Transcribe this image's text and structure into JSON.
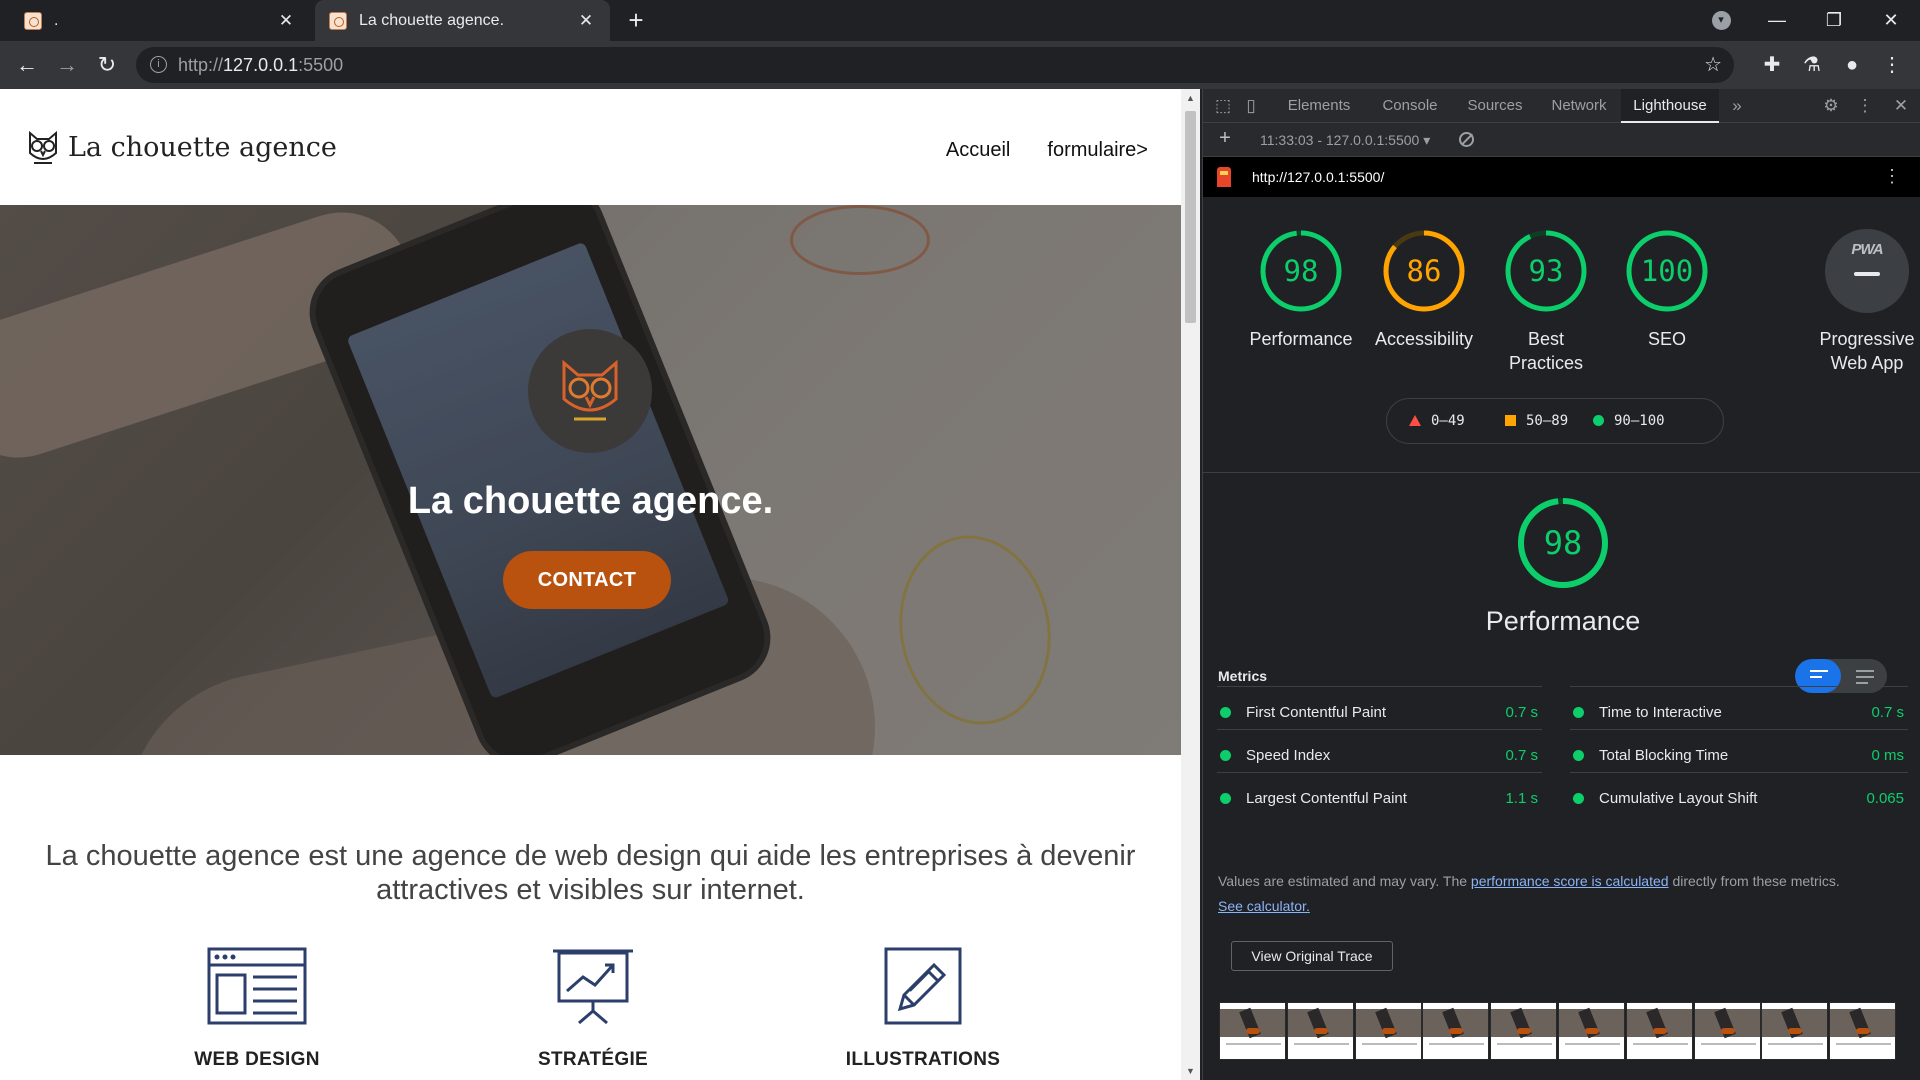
{
  "browser": {
    "tabs": [
      {
        "title": "."
      },
      {
        "title": "La chouette agence."
      }
    ],
    "address": {
      "scheme": "http://",
      "host": "127.0.0.1",
      "port": ":5500"
    },
    "icons": {
      "back": "arrow-left-icon",
      "forward": "arrow-right-icon",
      "reload": "reload-icon",
      "star": "bookmark-star-icon",
      "extensions": "puzzle-icon",
      "labs": "flask-icon",
      "profile": "person-icon",
      "menu": "kebab-menu-icon"
    }
  },
  "site": {
    "brand": "La chouette agence",
    "nav": [
      "Accueil",
      "formulaire>"
    ],
    "hero_title": "La chouette agence.",
    "cta": "CONTACT",
    "intro": "La chouette agence est une agence de web design qui aide les entreprises à devenir attractives et visibles sur internet.",
    "services": [
      {
        "label": "WEB DESIGN",
        "icon": "browser-window-icon"
      },
      {
        "label": "STRATÉGIE",
        "icon": "presentation-chart-icon"
      },
      {
        "label": "ILLUSTRATIONS",
        "icon": "pencil-icon"
      }
    ],
    "colors": {
      "accent": "#b9510f",
      "badge": "#3c3939"
    }
  },
  "devtools": {
    "tabs": [
      "Elements",
      "Console",
      "Sources",
      "Network",
      "Lighthouse"
    ],
    "active_tab": "Lighthouse",
    "overflow": "»",
    "run": "11:33:03 - 127.0.0.1:5500 ▾",
    "report_url": "http://127.0.0.1:5500/",
    "scores": [
      {
        "name": "Performance",
        "value": "98",
        "fraction": 0.98,
        "color": "#0cce6b"
      },
      {
        "name": "Accessibility",
        "value": "86",
        "fraction": 0.86,
        "color": "#ffa400"
      },
      {
        "name": "Best Practices",
        "value": "93",
        "fraction": 0.93,
        "color": "#0cce6b"
      },
      {
        "name": "SEO",
        "value": "100",
        "fraction": 1.0,
        "color": "#0cce6b"
      },
      {
        "name": "Progressive Web App",
        "badge": "PWA"
      }
    ],
    "legend": [
      "0–49",
      "50–89",
      "90–100"
    ],
    "performance": {
      "value": "98",
      "fraction": 0.98,
      "label": "Performance"
    },
    "metrics_title": "Metrics",
    "metrics": [
      {
        "name": "First Contentful Paint",
        "value": "0.7 s"
      },
      {
        "name": "Time to Interactive",
        "value": "0.7 s"
      },
      {
        "name": "Speed Index",
        "value": "0.7 s"
      },
      {
        "name": "Total Blocking Time",
        "value": "0 ms"
      },
      {
        "name": "Largest Contentful Paint",
        "value": "1.1 s"
      },
      {
        "name": "Cumulative Layout Shift",
        "value": "0.065"
      }
    ],
    "note": {
      "pre": "Values are estimated and may vary. The ",
      "link1": "performance score is calculated",
      "mid": " directly from these metrics. ",
      "link2": "See calculator."
    },
    "trace_button": "View Original Trace",
    "filmstrip_frames": 10
  }
}
